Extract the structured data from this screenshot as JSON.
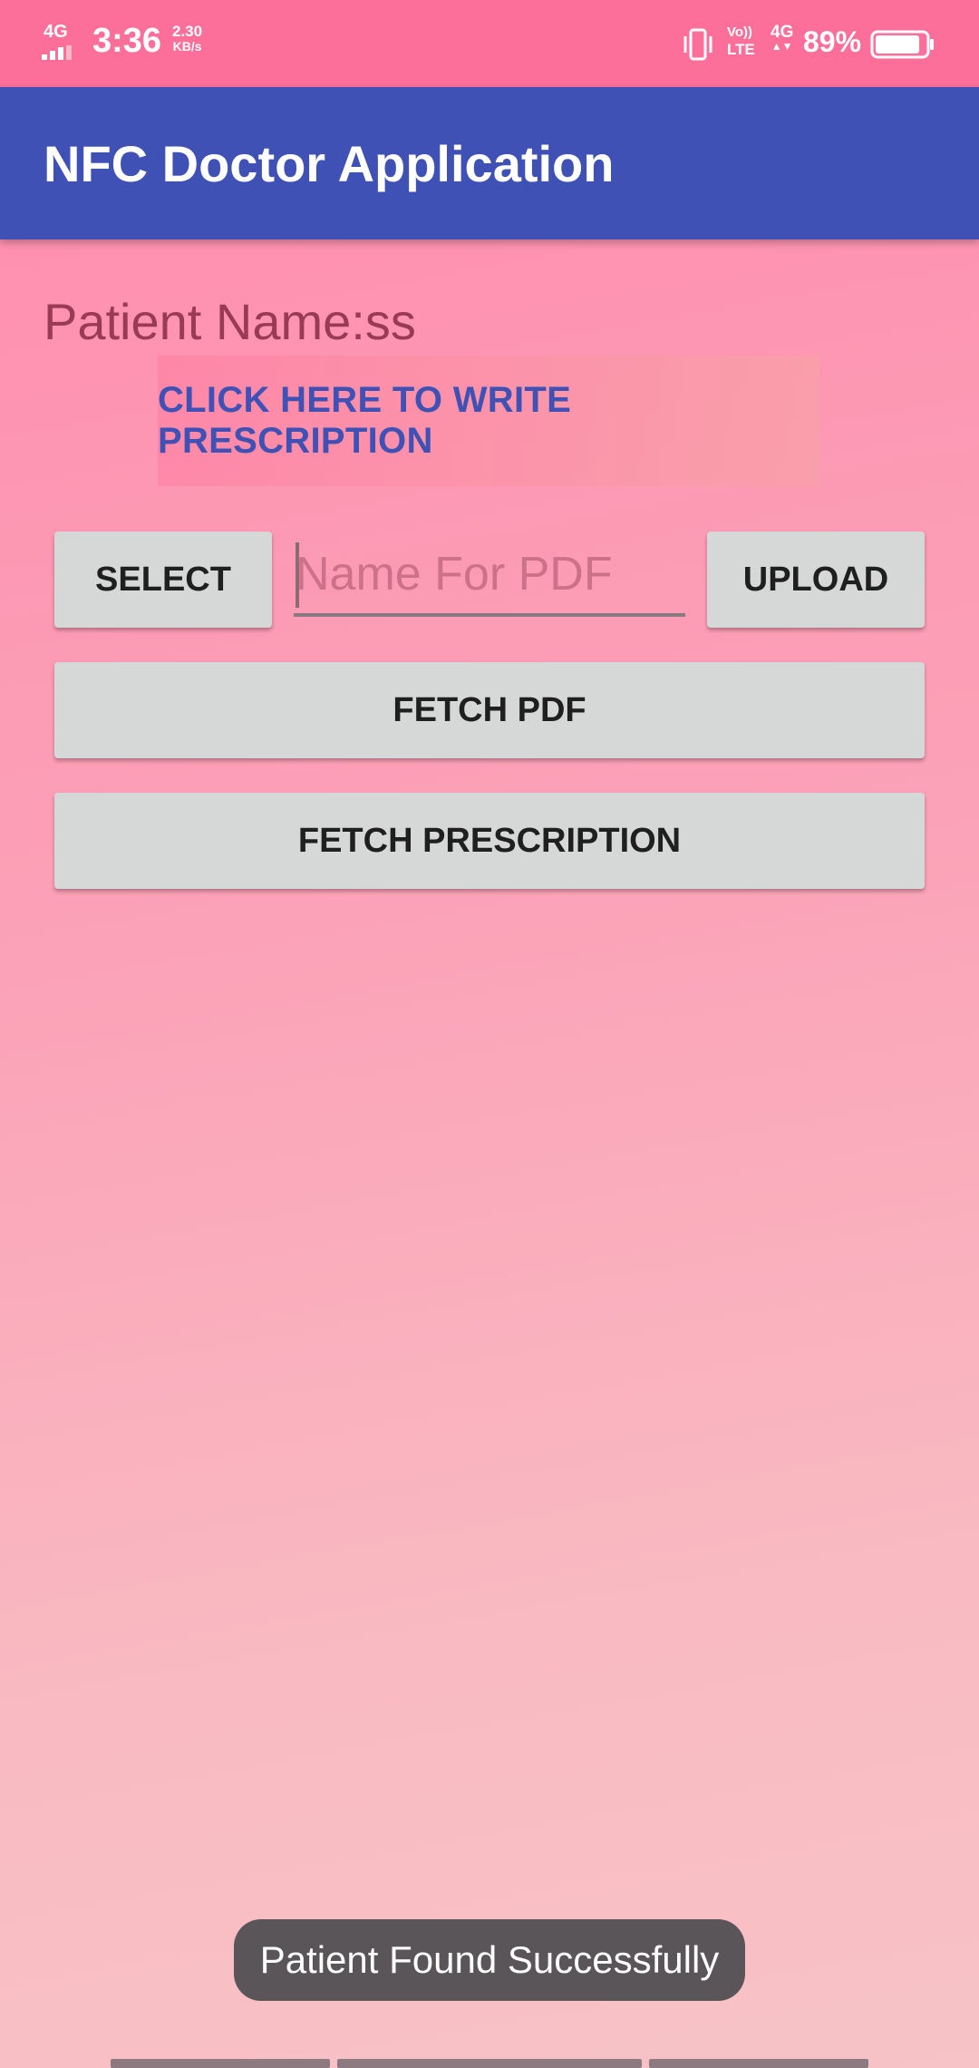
{
  "status_bar": {
    "network_left": "4G",
    "time": "3:36",
    "speed_value": "2.30",
    "speed_unit": "KB/s",
    "volte_top": "Vo))",
    "volte_bottom": "LTE",
    "network_right": "4G",
    "battery_percent": "89%",
    "battery_level": 0.89,
    "icons": [
      "signal-icon",
      "vibrate-icon",
      "battery-icon"
    ]
  },
  "app_bar": {
    "title": "NFC Doctor Application",
    "color": "#3f51b5"
  },
  "content": {
    "patient_name": "Patient Name:ss",
    "write_prescription_label": "CLICK HERE TO WRITE PRESCRIPTION",
    "select_label": "SELECT",
    "pdf_name_placeholder": "Name For PDF",
    "pdf_name_value": "",
    "upload_label": "UPLOAD",
    "fetch_pdf_label": "FETCH PDF",
    "fetch_prescription_label": "FETCH PRESCRIPTION"
  },
  "toast": {
    "message": "Patient Found Successfully"
  },
  "colors": {
    "status_bar": "#fb6f9a",
    "accent": "#3f51b5",
    "button_bg": "#d6d7d7"
  }
}
